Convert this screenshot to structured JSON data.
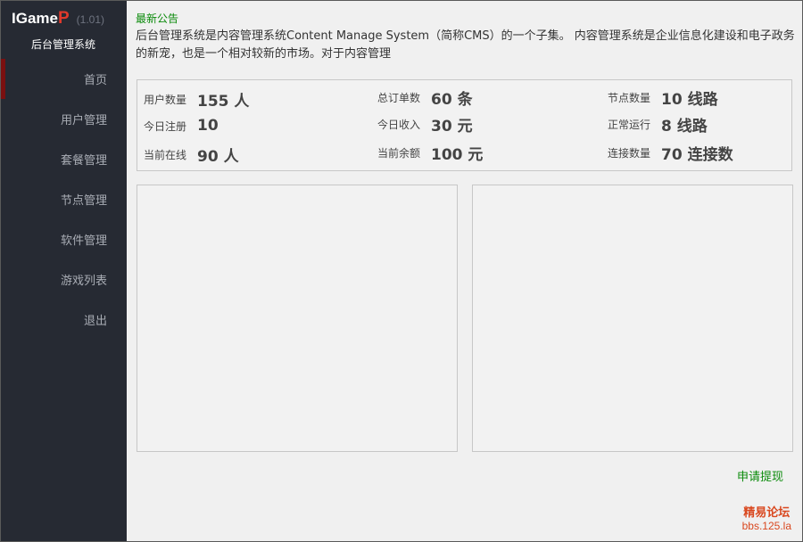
{
  "brand": {
    "name": "IGame",
    "name_p": "P",
    "version": "(1.01)",
    "subtitle": "后台管理系统"
  },
  "sidebar": {
    "items": [
      {
        "label": "首页",
        "active": true
      },
      {
        "label": "用户管理",
        "active": false
      },
      {
        "label": "套餐管理",
        "active": false
      },
      {
        "label": "节点管理",
        "active": false
      },
      {
        "label": "软件管理",
        "active": false
      },
      {
        "label": "游戏列表",
        "active": false
      },
      {
        "label": "退出",
        "active": false
      }
    ]
  },
  "notice": {
    "title": "最新公告",
    "body": "后台管理系统是内容管理系统Content Manage System（简称CMS）的一个子集。 内容管理系统是企业信息化建设和电子政务的新宠，也是一个相对较新的市场。对于内容管理"
  },
  "stats": {
    "user_count_label": "用户数量",
    "user_count_value": "155 人",
    "today_reg_label": "今日注册",
    "today_reg_value": "10",
    "online_label": "当前在线",
    "online_value": "90 人",
    "orders_label": "总订单数",
    "orders_value": "60 条",
    "today_income_label": "今日收入",
    "today_income_value": "30 元",
    "balance_label": "当前余额",
    "balance_value": "100 元",
    "nodes_label": "节点数量",
    "nodes_value": "10 线路",
    "running_label": "正常运行",
    "running_value": "8 线路",
    "connections_label": "连接数量",
    "connections_value": "70 连接数"
  },
  "actions": {
    "apply_withdraw": "申请提现"
  },
  "watermark": {
    "line1": "精易论坛",
    "line2": "bbs.125.la"
  },
  "colors": {
    "sidebar_bg": "#262a33",
    "accent_green": "#0a8a0a",
    "brand_red": "#e0392b",
    "active_marker": "#7a1010"
  }
}
